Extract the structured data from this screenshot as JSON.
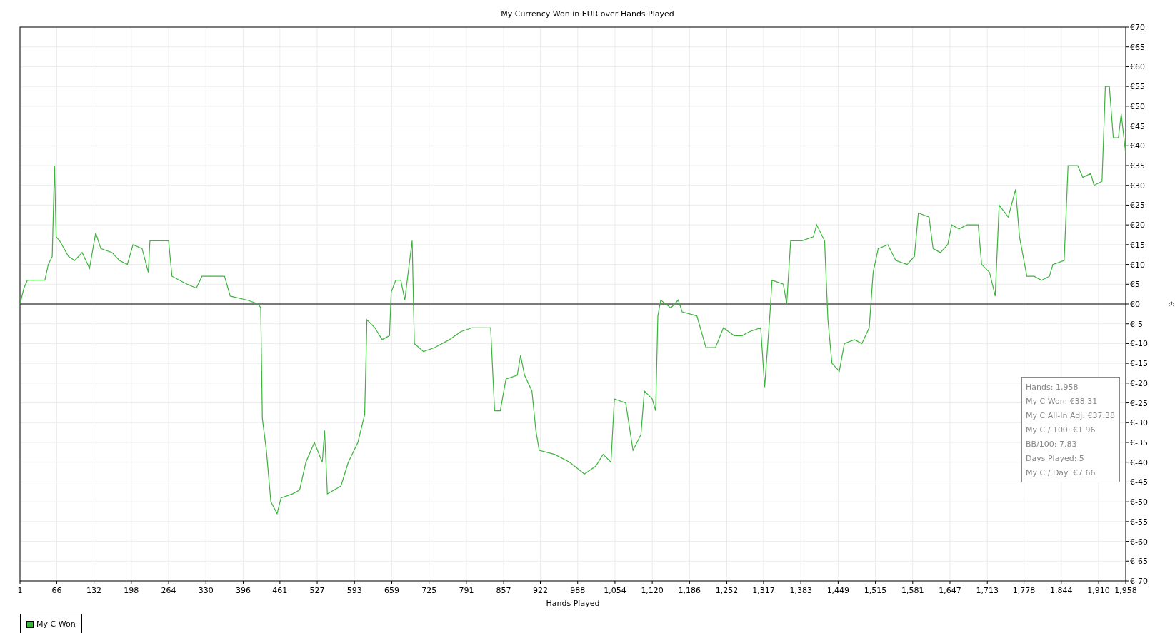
{
  "chart_data": {
    "type": "line",
    "grid": true,
    "title": "My Currency Won in EUR over Hands Played",
    "xlabel": "Hands Played",
    "ylabel": "€",
    "x": [
      1,
      8,
      14,
      45,
      51,
      58,
      62,
      65,
      71,
      87,
      98,
      111,
      124,
      135,
      144,
      164,
      177,
      191,
      201,
      217,
      228,
      231,
      264,
      270,
      297,
      313,
      323,
      363,
      373,
      403,
      423,
      427,
      430,
      437,
      445,
      456,
      463,
      483,
      496,
      507,
      522,
      536,
      540,
      545,
      569,
      582,
      599,
      611,
      615,
      629,
      642,
      655,
      658,
      666,
      675,
      682,
      695,
      699,
      715,
      735,
      761,
      781,
      801,
      834,
      841,
      851,
      861,
      881,
      887,
      894,
      907,
      914,
      920,
      947,
      974,
      1000,
      1020,
      1033,
      1047,
      1053,
      1073,
      1086,
      1100,
      1106,
      1120,
      1126,
      1130,
      1135,
      1153,
      1166,
      1173,
      1199,
      1215,
      1232,
      1246,
      1265,
      1279,
      1292,
      1312,
      1319,
      1329,
      1332,
      1352,
      1358,
      1365,
      1385,
      1405,
      1411,
      1425,
      1431,
      1438,
      1451,
      1460,
      1478,
      1491,
      1504,
      1511,
      1520,
      1537,
      1551,
      1571,
      1584,
      1591,
      1610,
      1617,
      1630,
      1643,
      1650,
      1663,
      1677,
      1697,
      1703,
      1717,
      1727,
      1734,
      1750,
      1763,
      1770,
      1783,
      1796,
      1809,
      1823,
      1829,
      1849,
      1856,
      1873,
      1882,
      1896,
      1902,
      1916,
      1922,
      1929,
      1936,
      1945,
      1950,
      1958
    ],
    "series": [
      {
        "name": "My C Won",
        "color": "#3cb43c",
        "values": [
          0,
          4,
          6,
          6,
          10,
          12,
          35,
          17,
          16,
          12,
          11,
          13,
          9,
          18,
          14,
          13,
          11,
          10,
          15,
          14,
          8,
          16,
          16,
          7,
          5,
          4,
          7,
          7,
          2,
          1,
          0,
          -1,
          -29,
          -37,
          -50,
          -53,
          -49,
          -48,
          -47,
          -40,
          -35,
          -40,
          -32,
          -48,
          -46,
          -40,
          -35,
          -28,
          -4,
          -6,
          -9,
          -8,
          3,
          6,
          6,
          1,
          16,
          -10,
          -12,
          -11,
          -9,
          -7,
          -6,
          -6,
          -27,
          -27,
          -19,
          -18,
          -13,
          -18,
          -22,
          -32,
          -37,
          -38,
          -40,
          -43,
          -41,
          -38,
          -40,
          -24,
          -25,
          -37,
          -33,
          -22,
          -24,
          -27,
          -3,
          1,
          -1,
          1,
          -2,
          -3,
          -11,
          -11,
          -6,
          -8,
          -8,
          -7,
          -6,
          -21,
          -1,
          6,
          5,
          0,
          16,
          16,
          17,
          20,
          16,
          -4,
          -15,
          -17,
          -10,
          -9,
          -10,
          -6,
          8,
          14,
          15,
          11,
          10,
          12,
          23,
          22,
          14,
          13,
          15,
          20,
          19,
          20,
          20,
          10,
          8,
          2,
          25,
          22,
          29,
          17,
          7,
          7,
          6,
          7,
          10,
          11,
          35,
          35,
          32,
          33,
          30,
          31,
          55,
          55,
          42,
          42,
          48,
          38
        ]
      }
    ],
    "xlim": [
      1,
      1958
    ],
    "ylim": [
      -70,
      70
    ],
    "xticks": [
      1,
      66,
      132,
      198,
      264,
      330,
      396,
      461,
      527,
      593,
      659,
      725,
      791,
      857,
      922,
      988,
      {
        "value": 1054,
        "label": "1,054"
      },
      {
        "value": 1120,
        "label": "1,120"
      },
      {
        "value": 1186,
        "label": "1,186"
      },
      {
        "value": 1252,
        "label": "1,252"
      },
      {
        "value": 1317,
        "label": "1,317"
      },
      {
        "value": 1383,
        "label": "1,383"
      },
      {
        "value": 1449,
        "label": "1,449"
      },
      {
        "value": 1515,
        "label": "1,515"
      },
      {
        "value": 1581,
        "label": "1,581"
      },
      {
        "value": 1647,
        "label": "1,647"
      },
      {
        "value": 1713,
        "label": "1,713"
      },
      {
        "value": 1778,
        "label": "1,778"
      },
      {
        "value": 1844,
        "label": "1,844"
      },
      {
        "value": 1910,
        "label": "1,910"
      },
      {
        "value": 1958,
        "label": "1,958"
      }
    ],
    "yticks": [
      {
        "value": 70,
        "label": "€70"
      },
      {
        "value": 65,
        "label": "€65"
      },
      {
        "value": 60,
        "label": "€60"
      },
      {
        "value": 55,
        "label": "€55"
      },
      {
        "value": 50,
        "label": "€50"
      },
      {
        "value": 45,
        "label": "€45"
      },
      {
        "value": 40,
        "label": "€40"
      },
      {
        "value": 35,
        "label": "€35"
      },
      {
        "value": 30,
        "label": "€30"
      },
      {
        "value": 25,
        "label": "€25"
      },
      {
        "value": 20,
        "label": "€20"
      },
      {
        "value": 15,
        "label": "€15"
      },
      {
        "value": 10,
        "label": "€10"
      },
      {
        "value": 5,
        "label": "€5"
      },
      {
        "value": 0,
        "label": "€0"
      },
      {
        "value": -5,
        "label": "€-5"
      },
      {
        "value": -10,
        "label": "€-10"
      },
      {
        "value": -15,
        "label": "€-15"
      },
      {
        "value": -20,
        "label": "€-20"
      },
      {
        "value": -25,
        "label": "€-25"
      },
      {
        "value": -30,
        "label": "€-30"
      },
      {
        "value": -35,
        "label": "€-35"
      },
      {
        "value": -40,
        "label": "€-40"
      },
      {
        "value": -45,
        "label": "€-45"
      },
      {
        "value": -50,
        "label": "€-50"
      },
      {
        "value": -55,
        "label": "€-55"
      },
      {
        "value": -60,
        "label": "€-60"
      },
      {
        "value": -65,
        "label": "€-65"
      },
      {
        "value": -70,
        "label": "€-70"
      }
    ]
  },
  "info_box": [
    "Hands: 1,958",
    "My C Won: €38.31",
    "My C All-In Adj: €37.38",
    "My C / 100: €1.96",
    "BB/100: 7.83",
    "Days Played: 5",
    "My C / Day: €7.66"
  ]
}
